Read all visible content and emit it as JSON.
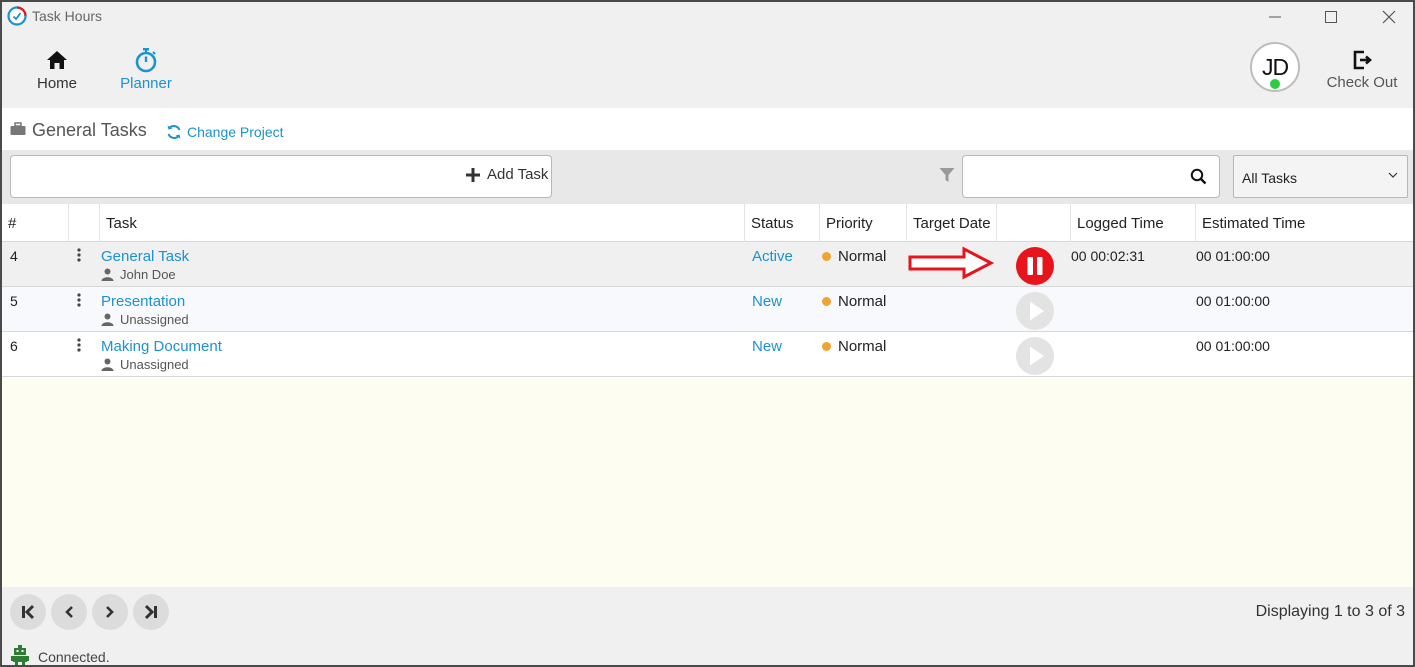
{
  "window": {
    "title": "Task Hours"
  },
  "toolbar": {
    "home_label": "Home",
    "planner_label": "Planner",
    "avatar_initials": "JD",
    "checkout_label": "Check Out"
  },
  "project": {
    "title": "General Tasks",
    "change_label": "Change Project"
  },
  "inputs": {
    "task_value": "",
    "add_task_label": "Add Task",
    "search_value": "",
    "filter_selected": "All Tasks"
  },
  "table": {
    "columns": [
      "#",
      "",
      "Task",
      "Status",
      "Priority",
      "Target Date",
      "",
      "Logged Time",
      "Estimated Time"
    ],
    "rows": [
      {
        "num": "4",
        "title": "General Task",
        "assignee": "John Doe",
        "status": "Active",
        "priority": "Normal",
        "target_date": "",
        "timer": "pause",
        "logged": "00 00:02:31",
        "estimated": "00 01:00:00"
      },
      {
        "num": "5",
        "title": "Presentation",
        "assignee": "Unassigned",
        "status": "New",
        "priority": "Normal",
        "target_date": "",
        "timer": "play",
        "logged": "",
        "estimated": "00 01:00:00"
      },
      {
        "num": "6",
        "title": "Making Document",
        "assignee": "Unassigned",
        "status": "New",
        "priority": "Normal",
        "target_date": "",
        "timer": "play",
        "logged": "",
        "estimated": "00 01:00:00"
      }
    ]
  },
  "pager": {
    "info": "Displaying 1 to 3 of 3"
  },
  "status": {
    "text": "Connected."
  },
  "colors": {
    "accent": "#1a93d0",
    "priority_normal": "#f0a330",
    "pause": "#e8141c",
    "online": "#2ecc40"
  }
}
